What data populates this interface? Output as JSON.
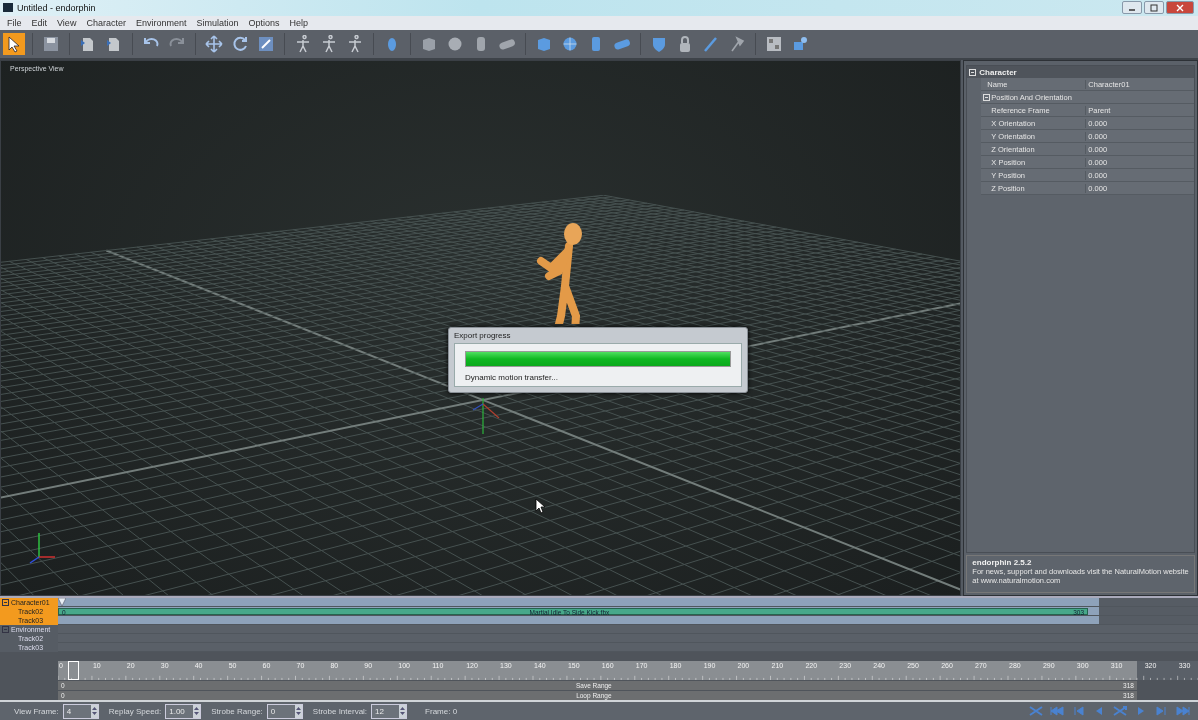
{
  "window": {
    "title": "Untitled - endorphin"
  },
  "menu": [
    "File",
    "Edit",
    "View",
    "Character",
    "Environment",
    "Simulation",
    "Options",
    "Help"
  ],
  "toolbar": {
    "tools": [
      {
        "selected": true
      },
      {
        "selected": false
      },
      {
        "selected": false
      },
      {
        "selected": false
      },
      {
        "selected": false
      },
      {
        "selected": false
      },
      {
        "selected": false
      },
      {
        "selected": false
      },
      {
        "selected": false
      },
      {
        "selected": false
      },
      {
        "selected": false
      },
      {
        "selected": false
      },
      {
        "selected": false
      },
      {
        "selected": false
      },
      {
        "selected": false
      },
      {
        "selected": false
      },
      {
        "selected": false
      },
      {
        "selected": false
      },
      {
        "selected": false
      },
      {
        "selected": false
      },
      {
        "selected": false
      },
      {
        "selected": false
      },
      {
        "selected": false
      },
      {
        "selected": false
      },
      {
        "selected": false
      },
      {
        "selected": false
      },
      {
        "selected": false
      }
    ]
  },
  "viewport": {
    "label": "Perspective View"
  },
  "dialog": {
    "title": "Export progress",
    "level": 1,
    "status": "Dynamic motion transfer..."
  },
  "properties": {
    "section": "Character",
    "expanded": true,
    "rows": [
      {
        "name": "Name",
        "value": "Character01"
      }
    ],
    "group": {
      "label": "Position And Orientation",
      "expanded": true,
      "rows": [
        {
          "name": "Reference Frame",
          "value": "Parent"
        },
        {
          "name": "X Orientation",
          "value": "0.000"
        },
        {
          "name": "Y Orientation",
          "value": "0.000"
        },
        {
          "name": "Z Orientation",
          "value": "0.000"
        },
        {
          "name": "X Position",
          "value": "0.000"
        },
        {
          "name": "Y Position",
          "value": "0.000"
        },
        {
          "name": "Z Position",
          "value": "0.000"
        }
      ]
    }
  },
  "info": {
    "title": "endorphin 2.5.2",
    "text": "For news, support and downloads visit the NaturalMotion website at www.naturalmotion.com"
  },
  "tracks": [
    {
      "label": "Character01",
      "selected": true,
      "expanded": true,
      "children": [
        {
          "label": "Track02",
          "clip": {
            "label": "Martial Idle To Side Kick.fbx",
            "start": "0",
            "end": "303"
          }
        },
        {
          "label": "Track03"
        }
      ]
    },
    {
      "label": "Environment",
      "selected": false,
      "expanded": true,
      "children": [
        {
          "label": "Track02"
        },
        {
          "label": "Track03"
        }
      ]
    }
  ],
  "ruler": {
    "ticks": [
      "0",
      "10",
      "20",
      "30",
      "40",
      "50",
      "60",
      "70",
      "80",
      "90",
      "100",
      "110",
      "120",
      "130",
      "140",
      "150",
      "160",
      "170",
      "180",
      "190",
      "200",
      "210",
      "220",
      "230",
      "240",
      "250",
      "260",
      "270",
      "280",
      "290",
      "300",
      "310",
      "320",
      "330"
    ]
  },
  "ranges": [
    {
      "label": "Save Range",
      "start": "0",
      "end": "318"
    },
    {
      "label": "Loop Range",
      "start": "0",
      "end": "318"
    }
  ],
  "fields": [
    {
      "label": "View Frame:",
      "value": "4"
    },
    {
      "label": "Replay Speed:",
      "value": "1.00"
    },
    {
      "label": "Strobe Range:",
      "value": "0"
    },
    {
      "label": "Strobe Interval:",
      "value": "12"
    }
  ],
  "frame": "Frame: 0"
}
